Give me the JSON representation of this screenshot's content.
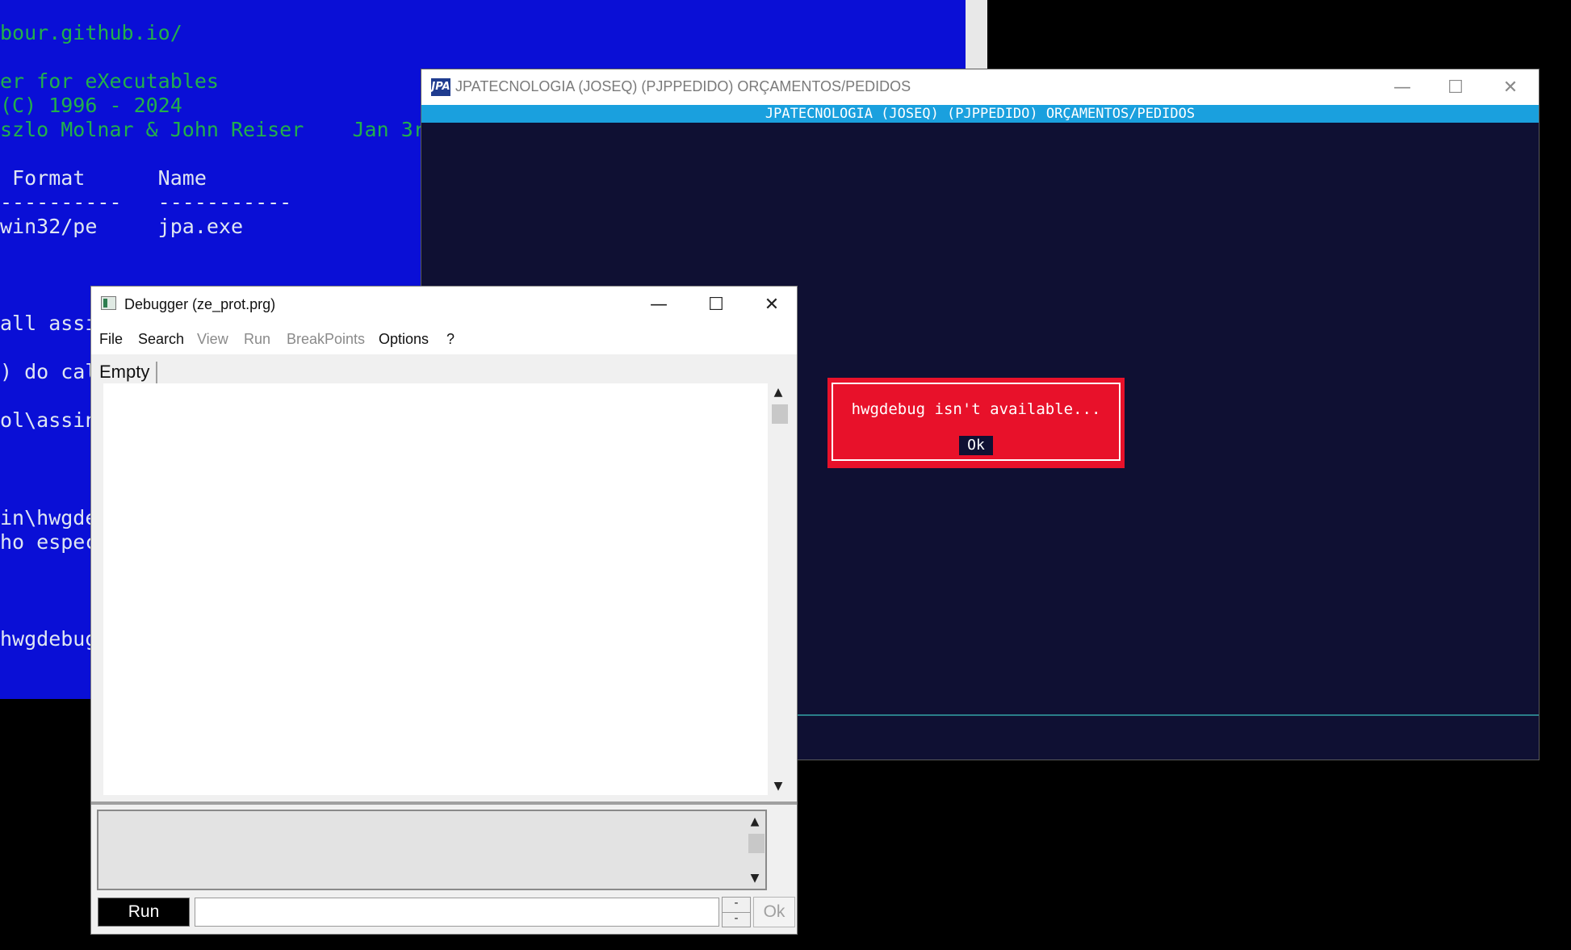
{
  "console": {
    "lines": [
      "bour.github.io/",
      "er for eXecutables",
      "(C) 1996 - 2024",
      "szlo Molnar & John Reiser    Jan 3r",
      " Format      Name",
      "----------   -----------",
      "win32/pe     jpa.exe",
      "all assi",
      ") do cal",
      "ol\\assin",
      "in\\hwgde",
      "ho espec",
      "hwgdebug"
    ]
  },
  "jpa_window": {
    "title": "JPATECNOLOGIA (JOSEQ) (PJPPEDIDO) ORÇAMENTOS/PEDIDOS",
    "logo": "JPA",
    "header": "JPATECNOLOGIA (JOSEQ) (PJPPEDIDO) ORÇAMENTOS/PEDIDOS",
    "controls": {
      "minimize": "—",
      "maximize": "☐",
      "close": "✕"
    },
    "dialog": {
      "message": "hwgdebug isn't available...",
      "ok_label": "Ok"
    }
  },
  "debugger": {
    "title": "Debugger (ze_prot.prg)",
    "controls": {
      "minimize": "—",
      "maximize": "☐",
      "close": "✕"
    },
    "menu": [
      {
        "label": "File",
        "enabled": true
      },
      {
        "label": "Search",
        "enabled": true
      },
      {
        "label": "View",
        "enabled": false
      },
      {
        "label": "Run",
        "enabled": false
      },
      {
        "label": "BreakPoints",
        "enabled": false
      },
      {
        "label": "Options",
        "enabled": true
      },
      {
        "label": "?",
        "enabled": true
      }
    ],
    "tab_label": "Empty",
    "run_label": "Run",
    "command_value": "",
    "spin_up": "-",
    "spin_down": "-",
    "ok_label": "Ok",
    "scroll_up": "▲",
    "scroll_down": "▼"
  },
  "colors": {
    "console_bg": "#0a0fd6",
    "console_text": "#22b04a",
    "jpa_bg": "#0f1033",
    "jpa_header": "#1aa0de",
    "dialog_bg": "#e8112a"
  }
}
